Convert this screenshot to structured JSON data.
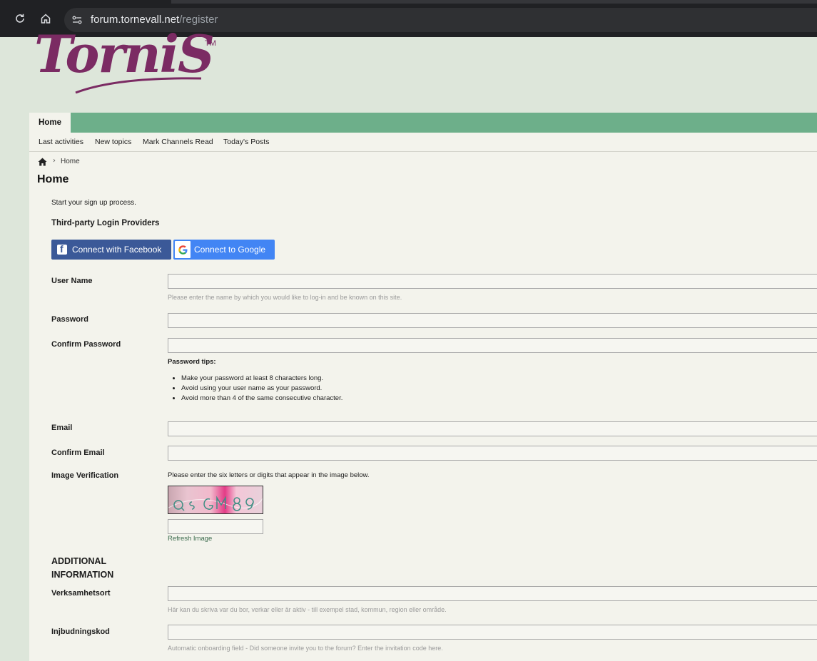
{
  "browser": {
    "url_host": "forum.tornevall.net",
    "url_path": "/register"
  },
  "site": {
    "logo_text": "TorniS",
    "logo_tm": "TM",
    "brand_color": "#7b2b63",
    "nav_color": "#6daf8a"
  },
  "nav": {
    "active_tab": "Home",
    "subnav": [
      "Last activities",
      "New topics",
      "Mark Channels Read",
      "Today's Posts"
    ]
  },
  "breadcrumb": {
    "current": "Home"
  },
  "page": {
    "title": "Home",
    "intro": "Start your sign up process.",
    "third_party_title": "Third-party Login Providers",
    "facebook_label": "Connect with Facebook",
    "google_label": "Connect to Google"
  },
  "form": {
    "username": {
      "label": "User Name",
      "value": "",
      "hint": "Please enter the name by which you would like to log-in and be known on this site."
    },
    "password": {
      "label": "Password",
      "value": ""
    },
    "confirm_password": {
      "label": "Confirm Password",
      "value": ""
    },
    "password_tips": {
      "title": "Password tips:",
      "items": [
        "Make your password at least 8 characters long.",
        "Avoid using your user name as your password.",
        "Avoid more than 4 of the same consecutive character."
      ]
    },
    "email": {
      "label": "Email",
      "value": ""
    },
    "confirm_email": {
      "label": "Confirm Email",
      "value": ""
    },
    "image_verification": {
      "label": "Image Verification",
      "hint": "Please enter the six letters or digits that appear in the image below.",
      "captcha_text": "Q5GM89",
      "value": "",
      "refresh_label": "Refresh Image"
    },
    "additional_title": "ADDITIONAL INFORMATION",
    "verksamhetsort": {
      "label": "Verksamhetsort",
      "value": "",
      "hint": "Här kan du skriva var du bor, verkar eller är aktiv - till exempel stad, kommun, region eller område."
    },
    "injbudningskod": {
      "label": "Injbudningskod",
      "value": "",
      "hint": "Automatic onboarding field - Did someone invite you to the forum? Enter the invitation code here."
    }
  }
}
